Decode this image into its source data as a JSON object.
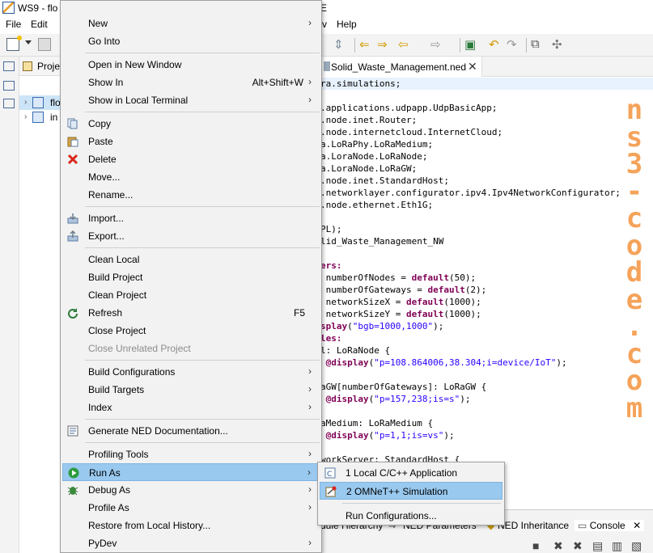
{
  "window": {
    "title_left": "WS9 - flo",
    "title_right": "E"
  },
  "menubar": {
    "file": "File",
    "edit": "Edit",
    "partial_view": "v",
    "help": "Help"
  },
  "explorer": {
    "tab_label": "Proje",
    "items": [
      {
        "label": "flo",
        "selected": true
      },
      {
        "label": "in",
        "selected": false
      }
    ]
  },
  "editor": {
    "tab_label": "Solid_Waste_Management.ned",
    "lines": [
      {
        "segs": [
          {
            "t": "ra.simulations;"
          }
        ],
        "hl": true
      },
      {
        "segs": [
          {
            "t": ""
          }
        ]
      },
      {
        "segs": [
          {
            "t": ".applications.udpapp.UdpBasicApp;"
          }
        ]
      },
      {
        "segs": [
          {
            "t": ".node.inet.Router;"
          }
        ]
      },
      {
        "segs": [
          {
            "t": ".node.internetcloud.InternetCloud;"
          }
        ]
      },
      {
        "segs": [
          {
            "t": "a.LoRaPhy.LoRaMedium;"
          }
        ]
      },
      {
        "segs": [
          {
            "t": "a.LoraNode.LoRaNode;"
          }
        ]
      },
      {
        "segs": [
          {
            "t": "a.LoraNode.LoRaGW;"
          }
        ]
      },
      {
        "segs": [
          {
            "t": ".node.inet.StandardHost;"
          }
        ]
      },
      {
        "segs": [
          {
            "t": ".networklayer.configurator.ipv4.Ipv4NetworkConfigurator;"
          }
        ]
      },
      {
        "segs": [
          {
            "t": ".node.ethernet.Eth1G;"
          }
        ]
      },
      {
        "segs": [
          {
            "t": ""
          }
        ]
      },
      {
        "segs": [
          {
            "t": "PL);"
          }
        ]
      },
      {
        "segs": [
          {
            "t": "lid_Waste_Management_NW"
          }
        ]
      },
      {
        "segs": [
          {
            "t": ""
          }
        ]
      },
      {
        "segs": [
          {
            "t": "ers:",
            "c": "kw"
          }
        ]
      },
      {
        "segs": [
          {
            "t": " numberOfNodes = "
          },
          {
            "t": "default",
            "c": "kw"
          },
          {
            "t": "(50);"
          }
        ]
      },
      {
        "segs": [
          {
            "t": " numberOfGateways = "
          },
          {
            "t": "default",
            "c": "kw"
          },
          {
            "t": "(2);"
          }
        ]
      },
      {
        "segs": [
          {
            "t": " networkSizeX = "
          },
          {
            "t": "default",
            "c": "kw"
          },
          {
            "t": "(1000);"
          }
        ]
      },
      {
        "segs": [
          {
            "t": " networkSizeY = "
          },
          {
            "t": "default",
            "c": "kw"
          },
          {
            "t": "(1000);"
          }
        ]
      },
      {
        "segs": [
          {
            "t": "splay",
            "c": "kw"
          },
          {
            "t": "("
          },
          {
            "t": "\"bgb=1000,1000\"",
            "c": "st"
          },
          {
            "t": ");"
          }
        ]
      },
      {
        "segs": [
          {
            "t": "les:",
            "c": "kw"
          }
        ]
      },
      {
        "segs": [
          {
            "t": "l: LoRaNode {"
          }
        ]
      },
      {
        "segs": [
          {
            "t": " @display",
            "c": "kw"
          },
          {
            "t": "("
          },
          {
            "t": "\"p=108.864006,38.304;i=device/IoT\"",
            "c": "st"
          },
          {
            "t": ");"
          }
        ]
      },
      {
        "segs": [
          {
            "t": ""
          }
        ]
      },
      {
        "segs": [
          {
            "t": "aGW[numberOfGateways]: LoRaGW {"
          }
        ]
      },
      {
        "segs": [
          {
            "t": " @display",
            "c": "kw"
          },
          {
            "t": "("
          },
          {
            "t": "\"p=157,238;is=s\"",
            "c": "st"
          },
          {
            "t": ");"
          }
        ]
      },
      {
        "segs": [
          {
            "t": ""
          }
        ]
      },
      {
        "segs": [
          {
            "t": "aMedium: LoRaMedium {"
          }
        ]
      },
      {
        "segs": [
          {
            "t": " @display",
            "c": "kw"
          },
          {
            "t": "("
          },
          {
            "t": "\"p=1,1;is=vs\"",
            "c": "st"
          },
          {
            "t": ");"
          }
        ]
      },
      {
        "segs": [
          {
            "t": ""
          }
        ]
      },
      {
        "segs": [
          {
            "t": "workServer: StandardHost {"
          }
        ]
      },
      {
        "segs": [
          {
            "t": ""
          }
        ]
      }
    ]
  },
  "watermark": {
    "chars": [
      "n",
      "s",
      "3",
      "-",
      "c",
      "o",
      "d",
      "e",
      ".",
      "c",
      "o",
      "m"
    ]
  },
  "bottom_panel": {
    "tabs": [
      {
        "label": "dule Hierarchy",
        "active": false
      },
      {
        "label": "NED Parameters",
        "active": false
      },
      {
        "label": "NED Inheritance",
        "active": false
      },
      {
        "label": "Console",
        "active": true
      }
    ],
    "close": "✕"
  },
  "context_menu": {
    "items": [
      {
        "id": "new",
        "label": "New",
        "submenu": true
      },
      {
        "id": "go-into",
        "label": "Go Into"
      },
      {
        "sep": true
      },
      {
        "id": "open-new-window",
        "label": "Open in New Window"
      },
      {
        "id": "show-in",
        "label": "Show In",
        "accel": "Alt+Shift+W",
        "submenu": true
      },
      {
        "id": "show-local-terminal",
        "label": "Show in Local Terminal",
        "submenu": true
      },
      {
        "sep": true
      },
      {
        "id": "copy",
        "label": "Copy",
        "icon": "copy-icon"
      },
      {
        "id": "paste",
        "label": "Paste",
        "icon": "paste-icon"
      },
      {
        "id": "delete",
        "label": "Delete",
        "icon": "delete-icon"
      },
      {
        "id": "move",
        "label": "Move..."
      },
      {
        "id": "rename",
        "label": "Rename..."
      },
      {
        "sep": true
      },
      {
        "id": "import",
        "label": "Import...",
        "icon": "import-icon"
      },
      {
        "id": "export",
        "label": "Export...",
        "icon": "export-icon"
      },
      {
        "sep": true
      },
      {
        "id": "clean-local",
        "label": "Clean Local"
      },
      {
        "id": "build-project",
        "label": "Build Project"
      },
      {
        "id": "clean-project",
        "label": "Clean Project"
      },
      {
        "id": "refresh",
        "label": "Refresh",
        "accel": "F5",
        "icon": "refresh-icon"
      },
      {
        "id": "close-project",
        "label": "Close Project"
      },
      {
        "id": "close-unrelated",
        "label": "Close Unrelated Project",
        "disabled": true
      },
      {
        "sep": true
      },
      {
        "id": "build-configurations",
        "label": "Build Configurations",
        "submenu": true
      },
      {
        "id": "build-targets",
        "label": "Build Targets",
        "submenu": true
      },
      {
        "id": "index",
        "label": "Index",
        "submenu": true
      },
      {
        "sep": true
      },
      {
        "id": "generate-ned-doc",
        "label": "Generate NED Documentation...",
        "icon": "ned-doc-icon"
      },
      {
        "sep": true
      },
      {
        "id": "profiling-tools",
        "label": "Profiling Tools",
        "submenu": true
      },
      {
        "id": "run-as",
        "label": "Run As",
        "submenu": true,
        "active": true,
        "icon": "run-icon"
      },
      {
        "id": "debug-as",
        "label": "Debug As",
        "submenu": true,
        "icon": "debug-icon"
      },
      {
        "id": "profile-as",
        "label": "Profile As",
        "submenu": true
      },
      {
        "id": "restore-history",
        "label": "Restore from Local History..."
      },
      {
        "id": "pydev",
        "label": "PyDev",
        "submenu": true
      }
    ]
  },
  "run_as_submenu": {
    "items": [
      {
        "id": "local-cpp",
        "label": "1 Local C/C++ Application",
        "icon": "cpp-app-icon"
      },
      {
        "id": "omnet-sim",
        "label": "2 OMNeT++ Simulation",
        "icon": "omnet-sim-icon",
        "active": true
      },
      {
        "sep": true
      },
      {
        "id": "run-configs",
        "label": "Run Configurations..."
      }
    ]
  },
  "colors": {
    "menu_bg": "#f2f2f2",
    "menu_highlight": "#99c9ef",
    "keyword": "#7f0055",
    "string": "#2a00ff",
    "watermark": "#f5a35a"
  }
}
